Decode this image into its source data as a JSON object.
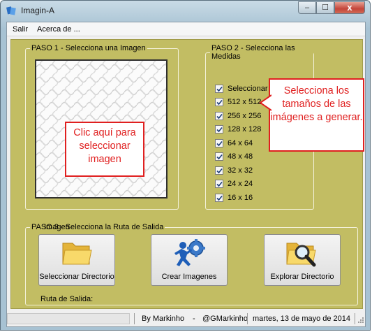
{
  "window": {
    "title": "Imagin-A",
    "minimize_label": "‒",
    "maximize_label": "☐",
    "close_label": "x"
  },
  "menu": {
    "file_label": "Salir",
    "about_label": "Acerca de ..."
  },
  "step1": {
    "legend": "PASO 1 - Selecciona una Imagen",
    "image_label": "Imagen",
    "annotation": "Clic aquí para seleccionar imagen"
  },
  "step2": {
    "legend": "PASO 2 - Selecciona las Medidas",
    "items": [
      {
        "label": "Seleccionar Todas",
        "checked": true
      },
      {
        "label": "512 x 512",
        "checked": true
      },
      {
        "label": "256 x 256",
        "checked": true
      },
      {
        "label": "128 x 128",
        "checked": true
      },
      {
        "label": "64 x 64",
        "checked": true
      },
      {
        "label": "48 x 48",
        "checked": true
      },
      {
        "label": "32 x 32",
        "checked": true
      },
      {
        "label": "24 x 24",
        "checked": true
      },
      {
        "label": "16 x 16",
        "checked": true
      }
    ],
    "annotation": "Selecciona los tamaños de las imágenes a generar."
  },
  "step3": {
    "legend": "PASO 3 - Selecciona la Ruta de Salida",
    "select_dir_label": "Seleccionar Directorio",
    "create_label": "Crear Imagenes",
    "explore_label": "Explorar Directorio",
    "output_path_label": "Ruta de Salida:"
  },
  "statusbar": {
    "author": "By Markinho",
    "dash": "-",
    "twitter": "@GMarkinho",
    "date": "martes, 13 de mayo de 2014"
  },
  "colors": {
    "panel": "#c2bd63",
    "annotation_red": "#e02020"
  }
}
